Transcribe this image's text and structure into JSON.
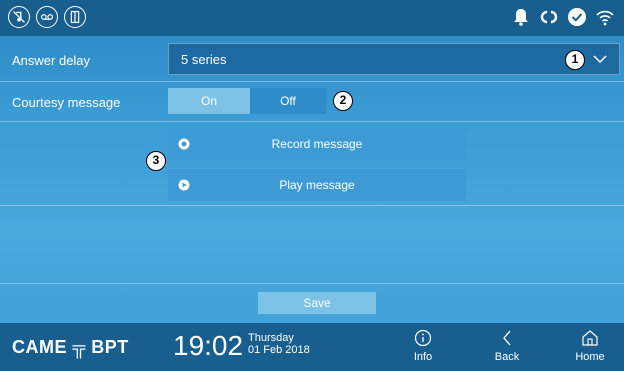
{
  "topbar": {
    "left_icons": [
      "mute-icon",
      "voicemail-icon",
      "door-icon"
    ],
    "right_icons": [
      "bell-icon",
      "connection-icon",
      "check-icon",
      "wifi-icon"
    ]
  },
  "settings": {
    "answer_delay": {
      "label": "Answer delay",
      "value": "5 series",
      "callout": "1"
    },
    "courtesy_message": {
      "label": "Courtesy message",
      "on": "On",
      "off": "Off",
      "selected": "On",
      "callout": "2"
    },
    "actions": {
      "callout": "3",
      "record": "Record message",
      "play": "Play message"
    },
    "save": "Save"
  },
  "bottombar": {
    "logo": "CAME ╦ BPT",
    "time": "19:02",
    "day": "Thursday",
    "date": "01 Feb 2018",
    "nav": {
      "info": "Info",
      "back": "Back",
      "home": "Home"
    }
  },
  "colors": {
    "bar": "#185f90",
    "panel": "#3d9ad5",
    "highlight": "#7cc1e6"
  }
}
